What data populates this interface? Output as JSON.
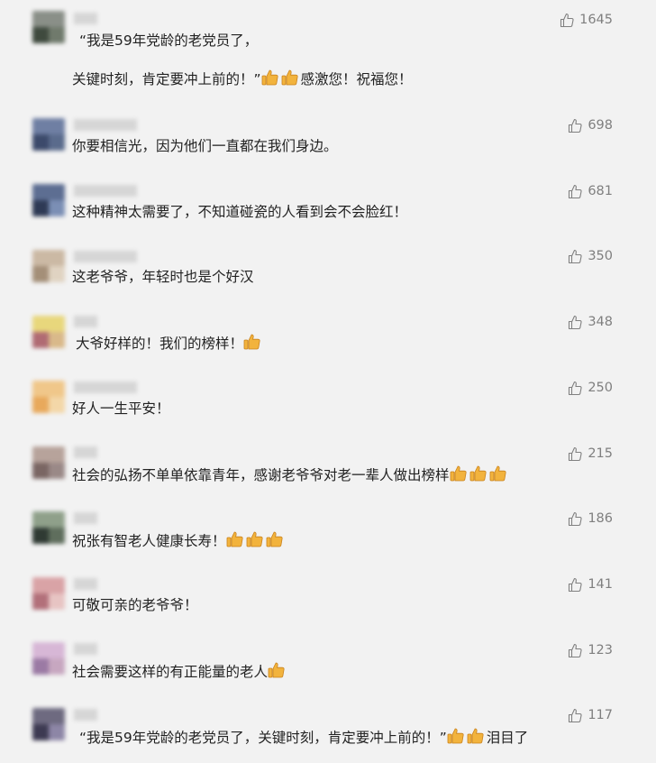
{
  "comments": [
    {
      "likes": "1645",
      "lines": [
        "“我是59年党龄的老党员了，",
        "关键时刻，肯定要冲上前的！”",
        "感激您！祝福您！"
      ],
      "avatar": [
        "#8a8f88",
        "#3f4a3e",
        "#707a6c"
      ]
    },
    {
      "likes": "698",
      "text": "你要相信光，因为他们一直都在我们身边。",
      "avatar": [
        "#6f7fa3",
        "#3c4a6b",
        "#5a6b8c"
      ]
    },
    {
      "likes": "681",
      "text": "这种精神太需要了，不知道碰瓷的人看到会不会脸红！",
      "avatar": [
        "#5d6e92",
        "#2e3a55",
        "#7b8fb5"
      ]
    },
    {
      "likes": "350",
      "text": "这老爷爷，年轻时也是个好汉",
      "avatar": [
        "#cbb9a4",
        "#a48f78",
        "#e0d3c2"
      ]
    },
    {
      "likes": "348",
      "text": "大爷好样的！我们的榜样！",
      "avatar": [
        "#e8d77c",
        "#b06b73",
        "#d9b98a"
      ]
    },
    {
      "likes": "250",
      "text": "好人一生平安！",
      "avatar": [
        "#f0c78a",
        "#e8a95c",
        "#f3d7a8"
      ]
    },
    {
      "likes": "215",
      "text": "社会的弘扬不单单依靠青年，感谢老爷爷对老一辈人做出榜样",
      "avatar": [
        "#b7a39b",
        "#7a6663",
        "#9a8987"
      ]
    },
    {
      "likes": "186",
      "text": "祝张有智老人健康长寿！",
      "avatar": [
        "#8fa08a",
        "#2f3a33",
        "#5f6e5d"
      ]
    },
    {
      "likes": "141",
      "text": "可敬可亲的老爷爷！",
      "avatar": [
        "#d9a3a6",
        "#b2707a",
        "#e7c4c3"
      ]
    },
    {
      "likes": "123",
      "text": "社会需要这样的有正能量的老人",
      "avatar": [
        "#d7b7d6",
        "#9b7aa4",
        "#c7a7c0"
      ]
    },
    {
      "likes": "117",
      "text": "“我是59年党龄的老党员了，关键时刻，肯定要冲上前的！”",
      "suffix": "泪目了",
      "avatar": [
        "#6e6a80",
        "#3d3a52",
        "#8d86a6"
      ]
    }
  ],
  "colors": {
    "background": "#f2f2f2",
    "text": "#222222",
    "likes": "#7f7f7f",
    "emoji": "#f2b33d"
  }
}
